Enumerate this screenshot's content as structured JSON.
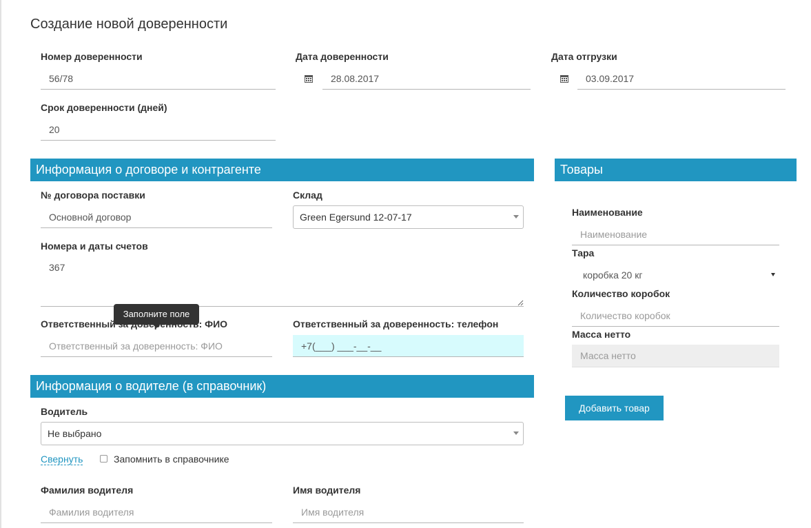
{
  "page_title": "Создание новой доверенности",
  "header_fields": {
    "number": {
      "label": "Номер доверенности",
      "value": "56/78"
    },
    "date": {
      "label": "Дата доверенности",
      "value": "28.08.2017",
      "icon": "calendar-icon"
    },
    "shipment_date": {
      "label": "Дата отгрузки",
      "value": "03.09.2017",
      "icon": "calendar-icon"
    },
    "term_days": {
      "label": "Срок доверенности (дней)",
      "value": "20"
    }
  },
  "contract_section": {
    "title": "Информация о договоре и контрагенте",
    "contract": {
      "label": "№ договора поставки",
      "value": "Основной договор"
    },
    "warehouse": {
      "label": "Склад",
      "value": "Green Egersund 12-07-17"
    },
    "invoices": {
      "label": "Номера и даты счетов",
      "value": "367"
    },
    "responsible_name": {
      "label": "Ответственный за доверенность: ФИО",
      "placeholder": "Ответственный за доверенность: ФИО"
    },
    "responsible_phone": {
      "label": "Ответственный за доверенность: телефон",
      "value": "+7(___) ___-__-__"
    },
    "tooltip": "Заполните поле"
  },
  "driver_section": {
    "title": "Информация о водителе (в справочник)",
    "driver": {
      "label": "Водитель",
      "value": "Не выбрано"
    },
    "collapse_link": "Свернуть",
    "remember_label": "Запомнить в справочнике",
    "remember_checked": false,
    "last_name": {
      "label": "Фамилия водителя",
      "placeholder": "Фамилия водителя"
    },
    "first_name": {
      "label": "Имя водителя",
      "placeholder": "Имя водителя"
    }
  },
  "goods_section": {
    "title": "Товары",
    "name": {
      "label": "Наименование",
      "placeholder": "Наименование"
    },
    "package": {
      "label": "Тара",
      "value": "коробка 20 кг"
    },
    "box_count": {
      "label": "Количество коробок",
      "placeholder": "Количество коробок"
    },
    "net_weight": {
      "label": "Масса нетто",
      "placeholder": "Масса нетто"
    },
    "add_button": "Добавить товар"
  },
  "colors": {
    "accent": "#2196c1",
    "highlight_field": "#d7fbfd",
    "tooltip_bg": "#333333"
  }
}
